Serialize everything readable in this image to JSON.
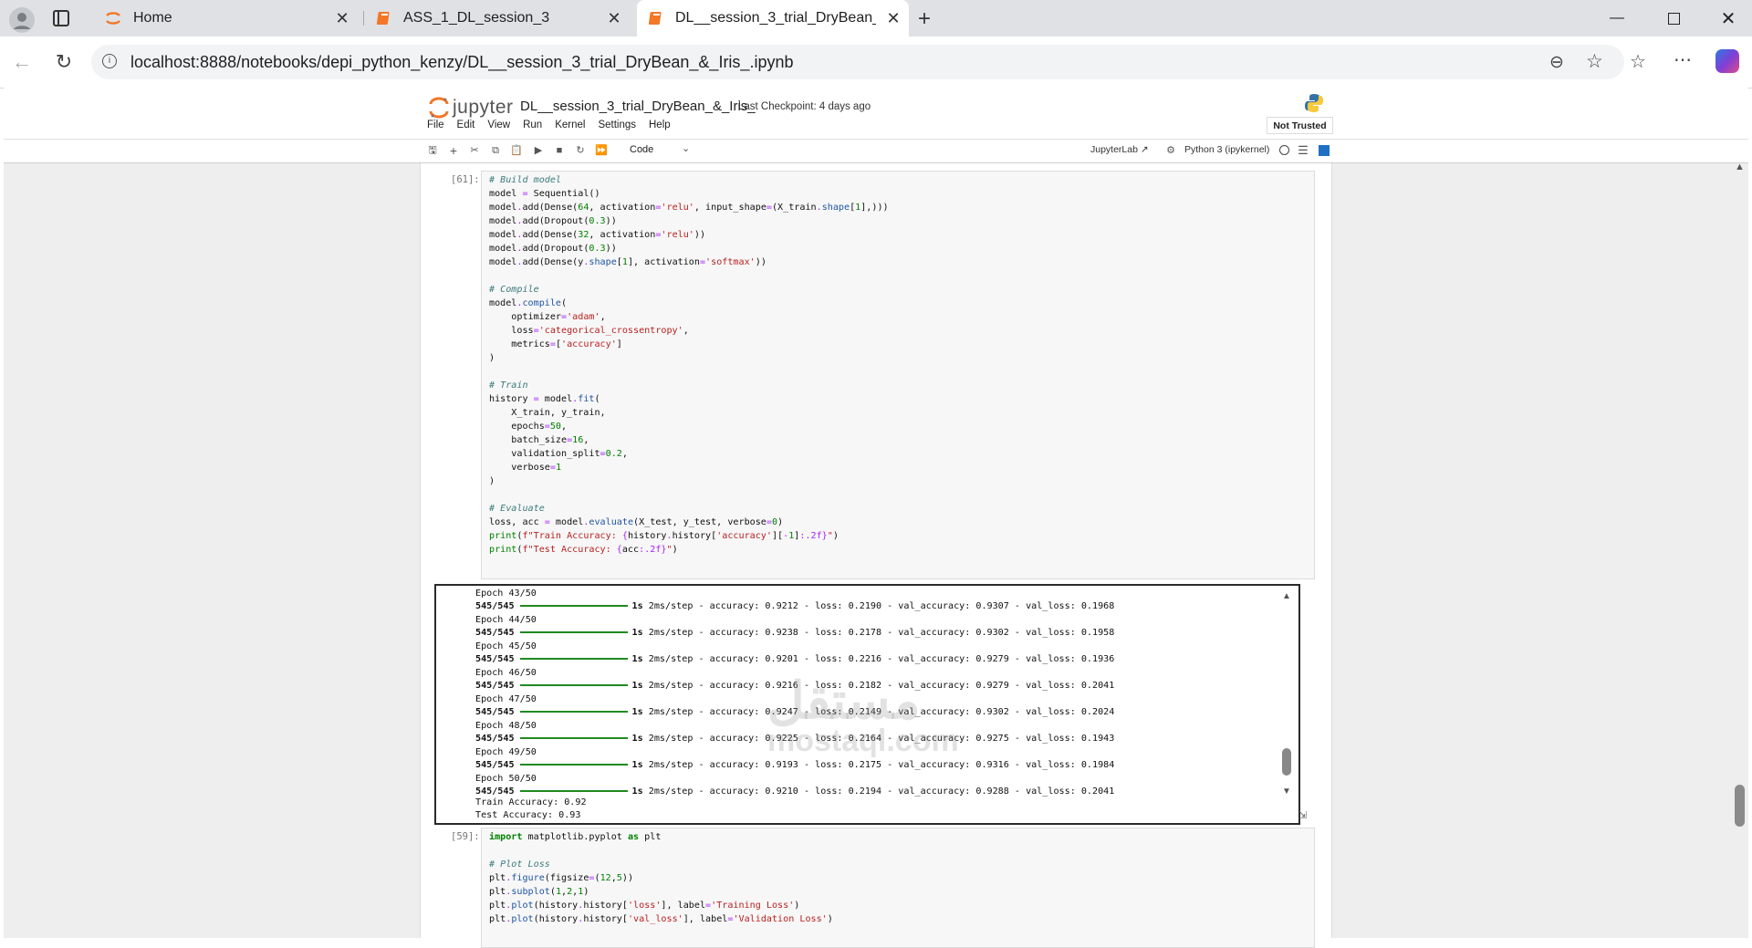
{
  "browser": {
    "tabs": [
      {
        "label": "Home",
        "icon": "jupyter-icon"
      },
      {
        "label": "ASS_1_DL_session_3",
        "icon": "notebook-icon"
      },
      {
        "label": "DL__session_3_trial_DryBean_&_Iris_",
        "icon": "notebook-icon",
        "active": true
      }
    ],
    "url": "localhost:8888/notebooks/depi_python_kenzy/DL__session_3_trial_DryBean_&_Iris_.ipynb"
  },
  "jupyter": {
    "logo_text": "jupyter",
    "notebook_name": "DL__session_3_trial_DryBean_&_Iris_",
    "checkpoint": "Last Checkpoint: 4 days ago",
    "menu": [
      "File",
      "Edit",
      "View",
      "Run",
      "Kernel",
      "Settings",
      "Help"
    ],
    "trust": "Not Trusted",
    "cell_type": "Code",
    "jupyterlab_link": "JupyterLab",
    "kernel": "Python 3 (ipykernel)"
  },
  "cells": {
    "cell1_prompt": "[61]:",
    "cell2_prompt": "[59]:",
    "output": {
      "epochs": [
        {
          "epoch": "Epoch 43/50",
          "steps": "545/545",
          "time": "1s",
          "step_time": "2ms/step",
          "accuracy": "0.9212",
          "loss": "0.2190",
          "val_accuracy": "0.9307",
          "val_loss": "0.1968"
        },
        {
          "epoch": "Epoch 44/50",
          "steps": "545/545",
          "time": "1s",
          "step_time": "2ms/step",
          "accuracy": "0.9238",
          "loss": "0.2178",
          "val_accuracy": "0.9302",
          "val_loss": "0.1958"
        },
        {
          "epoch": "Epoch 45/50",
          "steps": "545/545",
          "time": "1s",
          "step_time": "2ms/step",
          "accuracy": "0.9201",
          "loss": "0.2216",
          "val_accuracy": "0.9279",
          "val_loss": "0.1936"
        },
        {
          "epoch": "Epoch 46/50",
          "steps": "545/545",
          "time": "1s",
          "step_time": "2ms/step",
          "accuracy": "0.9216",
          "loss": "0.2182",
          "val_accuracy": "0.9279",
          "val_loss": "0.2041"
        },
        {
          "epoch": "Epoch 47/50",
          "steps": "545/545",
          "time": "1s",
          "step_time": "2ms/step",
          "accuracy": "0.9247",
          "loss": "0.2149",
          "val_accuracy": "0.9302",
          "val_loss": "0.2024"
        },
        {
          "epoch": "Epoch 48/50",
          "steps": "545/545",
          "time": "1s",
          "step_time": "2ms/step",
          "accuracy": "0.9225",
          "loss": "0.2164",
          "val_accuracy": "0.9275",
          "val_loss": "0.1943"
        },
        {
          "epoch": "Epoch 49/50",
          "steps": "545/545",
          "time": "1s",
          "step_time": "2ms/step",
          "accuracy": "0.9193",
          "loss": "0.2175",
          "val_accuracy": "0.9316",
          "val_loss": "0.1984"
        },
        {
          "epoch": "Epoch 50/50",
          "steps": "545/545",
          "time": "1s",
          "step_time": "2ms/step",
          "accuracy": "0.9210",
          "loss": "0.2194",
          "val_accuracy": "0.9288",
          "val_loss": "0.2041"
        }
      ],
      "train_accuracy": "Train Accuracy: 0.92",
      "test_accuracy": "Test Accuracy: 0.93"
    }
  },
  "watermark": {
    "arabic": "مستقل",
    "latin": "mostaql.com"
  },
  "colors": {
    "accent": "#0b57d0",
    "jupyter_orange": "#f37726",
    "progress_green": "#1f8a1f"
  }
}
